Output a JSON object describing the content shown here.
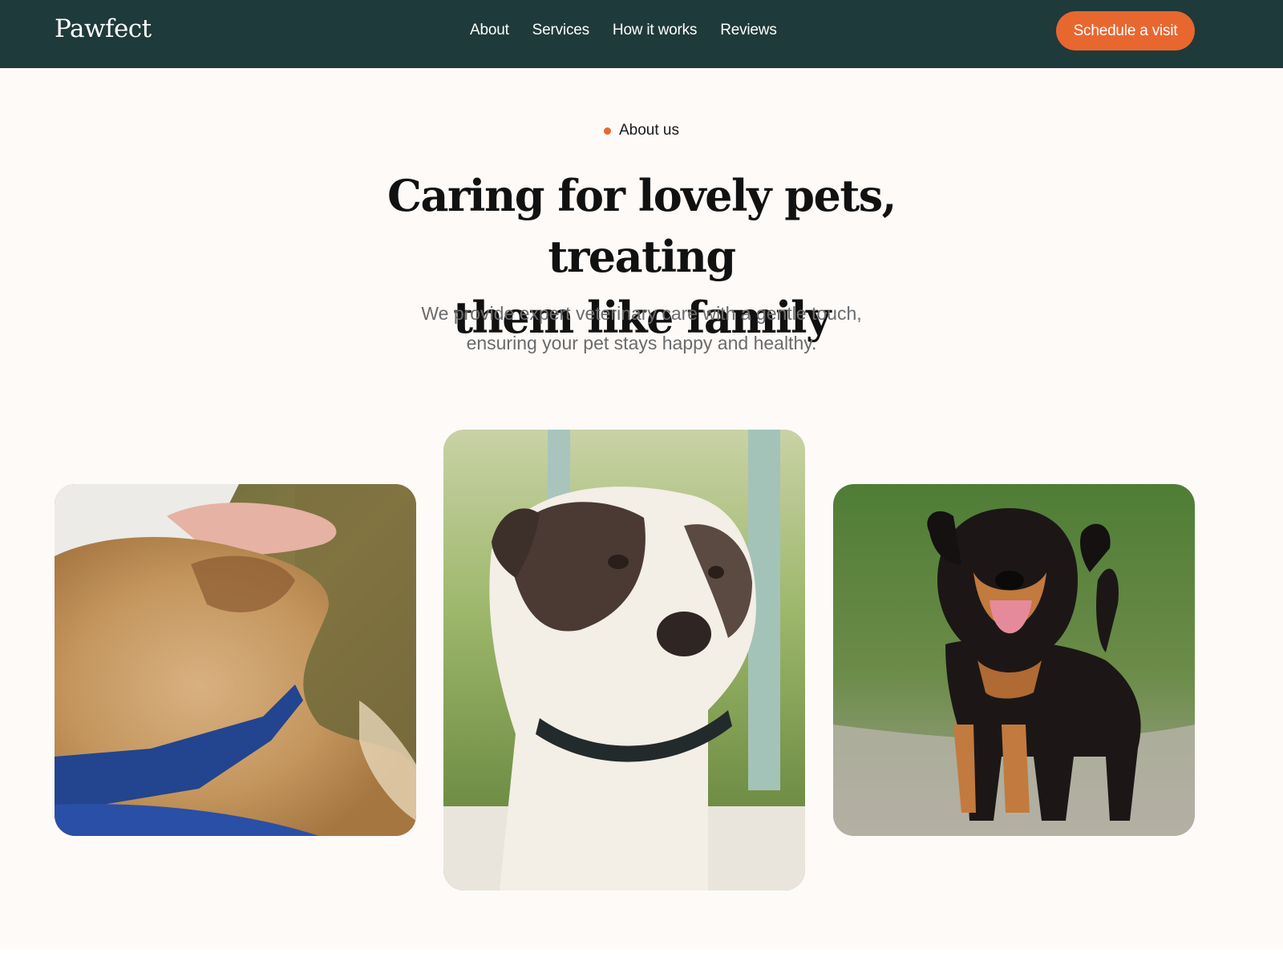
{
  "navbar": {
    "brand": "Pawfect",
    "links": [
      "About",
      "Services",
      "How it works",
      "Reviews"
    ],
    "cta_label": "Schedule a visit",
    "background": "#1f3a3a",
    "accent": "#e8672f"
  },
  "hero": {
    "eyebrow": "About us",
    "headline_line1": "Caring for lovely pets, treating",
    "headline_line2": "them like family",
    "subtext_line1": "We provide expert veterinary care with a gentle touch,",
    "subtext_line2": "ensuring your pet stays happy and healthy."
  },
  "gallery": {
    "photos": [
      {
        "subject": "golden fluffy dog being petted by a hand"
      },
      {
        "subject": "white and brown dog with collar"
      },
      {
        "subject": "black and tan puppy standing on grass"
      }
    ]
  }
}
